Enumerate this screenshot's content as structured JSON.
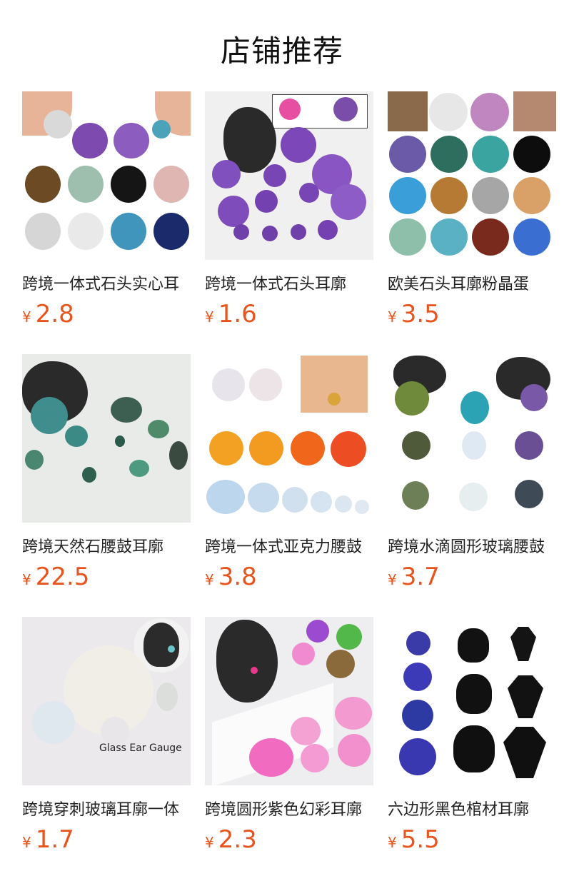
{
  "section": {
    "title": "店铺推荐"
  },
  "products": [
    {
      "name": "跨境一体式石头实心耳",
      "currency": "¥",
      "price": "2.8"
    },
    {
      "name": "跨境一体式石头耳廓",
      "currency": "¥",
      "price": "1.6"
    },
    {
      "name": "欧美石头耳廓粉晶蛋",
      "currency": "¥",
      "price": "3.5"
    },
    {
      "name": "跨境天然石腰鼓耳廓",
      "currency": "¥",
      "price": "22.5"
    },
    {
      "name": "跨境一体式亚克力腰鼓",
      "currency": "¥",
      "price": "3.8"
    },
    {
      "name": "跨境水滴圆形玻璃腰鼓",
      "currency": "¥",
      "price": "3.7"
    },
    {
      "name": "跨境穿刺玻璃耳廓一体",
      "currency": "¥",
      "price": "1.7"
    },
    {
      "name": "跨境圆形紫色幻彩耳廓",
      "currency": "¥",
      "price": "2.3"
    },
    {
      "name": "六边形黑色棺材耳廓",
      "currency": "¥",
      "price": "5.5"
    }
  ],
  "image_text": {
    "glass_caption": "Glass Ear Gauge"
  }
}
